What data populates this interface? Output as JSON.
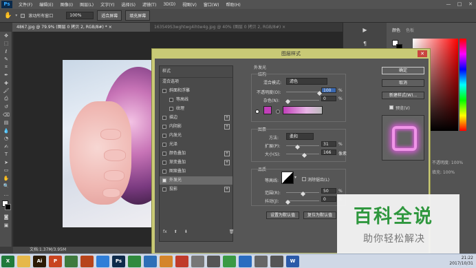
{
  "app": {
    "logo": "Ps"
  },
  "menubar": {
    "items": [
      "文件(F)",
      "编辑(E)",
      "图像(I)",
      "图层(L)",
      "文字(Y)",
      "选择(S)",
      "滤镜(T)",
      "3D(D)",
      "视图(V)",
      "窗口(W)",
      "帮助(H)"
    ],
    "window_buttons": [
      "—",
      "□",
      "✕"
    ]
  },
  "options_bar": {
    "scroll_all_windows": "滚动所有窗口",
    "zoom_value": "100%",
    "fit_screen": "适合屏幕",
    "fill_screen": "填充屏幕"
  },
  "doc_tabs": [
    {
      "label": "4867.jpg @ 79.9% (图层 0 拷贝 2, RGB/8#) *",
      "active": true
    },
    {
      "label": "163549S3wghtwg4ihtw4g.jpg @ 40% (图层 0 拷贝 2, RGB/8#)",
      "active": false
    }
  ],
  "status_bar": {
    "text": "文档:1.37M/3.95M"
  },
  "right_panel": {
    "tabs": [
      "颜色",
      "色板"
    ],
    "foreground_color": "#ffffff",
    "background_color": "#000000",
    "lower_texts": [
      "不透明度: 100%",
      "填充: 100%"
    ]
  },
  "dialog": {
    "title": "图层样式",
    "styles_header": "样式",
    "blend_options": "混合选项",
    "style_items": [
      {
        "label": "斜面和浮雕",
        "checked": false,
        "plus": false,
        "indent": false
      },
      {
        "label": "等高线",
        "checked": false,
        "plus": false,
        "indent": true
      },
      {
        "label": "纹理",
        "checked": false,
        "plus": false,
        "indent": true
      },
      {
        "label": "描边",
        "checked": false,
        "plus": true,
        "indent": false
      },
      {
        "label": "内阴影",
        "checked": false,
        "plus": true,
        "indent": false
      },
      {
        "label": "内发光",
        "checked": false,
        "plus": false,
        "indent": false
      },
      {
        "label": "光泽",
        "checked": false,
        "plus": false,
        "indent": false
      },
      {
        "label": "颜色叠加",
        "checked": false,
        "plus": true,
        "indent": false
      },
      {
        "label": "渐变叠加",
        "checked": false,
        "plus": true,
        "indent": false
      },
      {
        "label": "图案叠加",
        "checked": false,
        "plus": false,
        "indent": false
      },
      {
        "label": "外发光",
        "checked": true,
        "plus": false,
        "indent": false,
        "selected": true
      },
      {
        "label": "投影",
        "checked": false,
        "plus": true,
        "indent": false
      }
    ],
    "bottom_icons": [
      "fx",
      "⬆",
      "⬇",
      "🗑"
    ],
    "outer_glow": {
      "section_title": "外发光",
      "structure": "结构",
      "blend_mode_label": "混合模式:",
      "blend_mode_value": "滤色",
      "opacity_label": "不透明度(O):",
      "opacity_value": 100,
      "noise_label": "杂色(N):",
      "noise_value": 0,
      "percent": "%",
      "glow_color": "#c13fb9",
      "elements": "图素",
      "method_label": "方法:",
      "method_value": "柔和",
      "spread_label": "扩展(P):",
      "spread_value": 31,
      "size_label": "大小(S):",
      "size_value": 166,
      "pixel": "像素",
      "quality": "品质",
      "contour_label": "等高线:",
      "antialias_label": "消除锯齿(L)",
      "range_label": "范围(R):",
      "range_value": 50,
      "jitter_label": "抖动(J):",
      "jitter_value": 0,
      "set_default": "设置为默认值",
      "reset_default": "复位为默认值"
    },
    "buttons": {
      "ok": "确定",
      "cancel": "取消",
      "new_style": "新建样式(W)...",
      "preview": "预览(V)"
    }
  },
  "taskbar": {
    "apps": [
      {
        "name": "excel",
        "label": "X",
        "color": "#1f7a3a"
      },
      {
        "name": "folder",
        "label": "",
        "color": "#e6b84a"
      },
      {
        "name": "illustrator",
        "label": "Ai",
        "color": "#2b1a05"
      },
      {
        "name": "powerpoint",
        "label": "P",
        "color": "#c8441f"
      },
      {
        "name": "images",
        "label": "",
        "color": "#3e7a3e"
      },
      {
        "name": "app2",
        "label": "",
        "color": "#b7441b"
      },
      {
        "name": "baidu-netdisk",
        "label": "",
        "color": "#2f7ed8"
      },
      {
        "name": "photoshop",
        "label": "Ps",
        "color": "#0d2a4a"
      },
      {
        "name": "app3",
        "label": "",
        "color": "#2f8a3e"
      },
      {
        "name": "browser",
        "label": "",
        "color": "#2d6fb7"
      },
      {
        "name": "app4",
        "label": "",
        "color": "#d4852a"
      },
      {
        "name": "app5",
        "label": "",
        "color": "#c03b2b"
      },
      {
        "name": "app6",
        "label": "",
        "color": "#777"
      },
      {
        "name": "app7",
        "label": "",
        "color": "#555"
      },
      {
        "name": "app8",
        "label": "",
        "color": "#3a9a44"
      },
      {
        "name": "app9",
        "label": "",
        "color": "#2a6dc0"
      },
      {
        "name": "app10",
        "label": "",
        "color": "#666"
      },
      {
        "name": "app11",
        "label": "",
        "color": "#555"
      },
      {
        "name": "word",
        "label": "W",
        "color": "#2b5aa8"
      }
    ],
    "time": "21:22",
    "date": "2017/10/31"
  },
  "watermark": {
    "title": "百科全说",
    "subtitle": "助你轻松解决"
  }
}
